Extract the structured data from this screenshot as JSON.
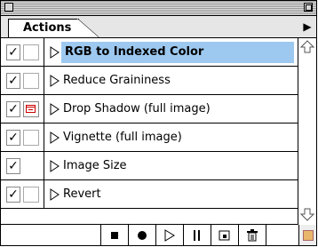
{
  "palette": {
    "tab_label": "Actions",
    "menu_glyph": "▶"
  },
  "actions": [
    {
      "label": "RGB to Indexed Color",
      "checked": "✓",
      "dialog": false,
      "selected": true
    },
    {
      "label": "Reduce Graininess",
      "checked": "✓",
      "dialog": false,
      "selected": false
    },
    {
      "label": "Drop Shadow (full image)",
      "checked": "✓",
      "dialog": true,
      "selected": false
    },
    {
      "label": "Vignette (full image)",
      "checked": "✓",
      "dialog": false,
      "selected": false
    },
    {
      "label": "Image Size",
      "checked": "✓",
      "dialog": false,
      "selected": false
    },
    {
      "label": "Revert",
      "checked": "✓",
      "dialog": false,
      "selected": false
    }
  ],
  "toolbar": {
    "buttons": [
      "stop-icon",
      "record-icon",
      "play-icon",
      "new-set-icon",
      "new-action-icon",
      "trash-icon"
    ]
  },
  "colors": {
    "selection": "#9dc9f0",
    "dialog_indicator": "#cc0000"
  }
}
